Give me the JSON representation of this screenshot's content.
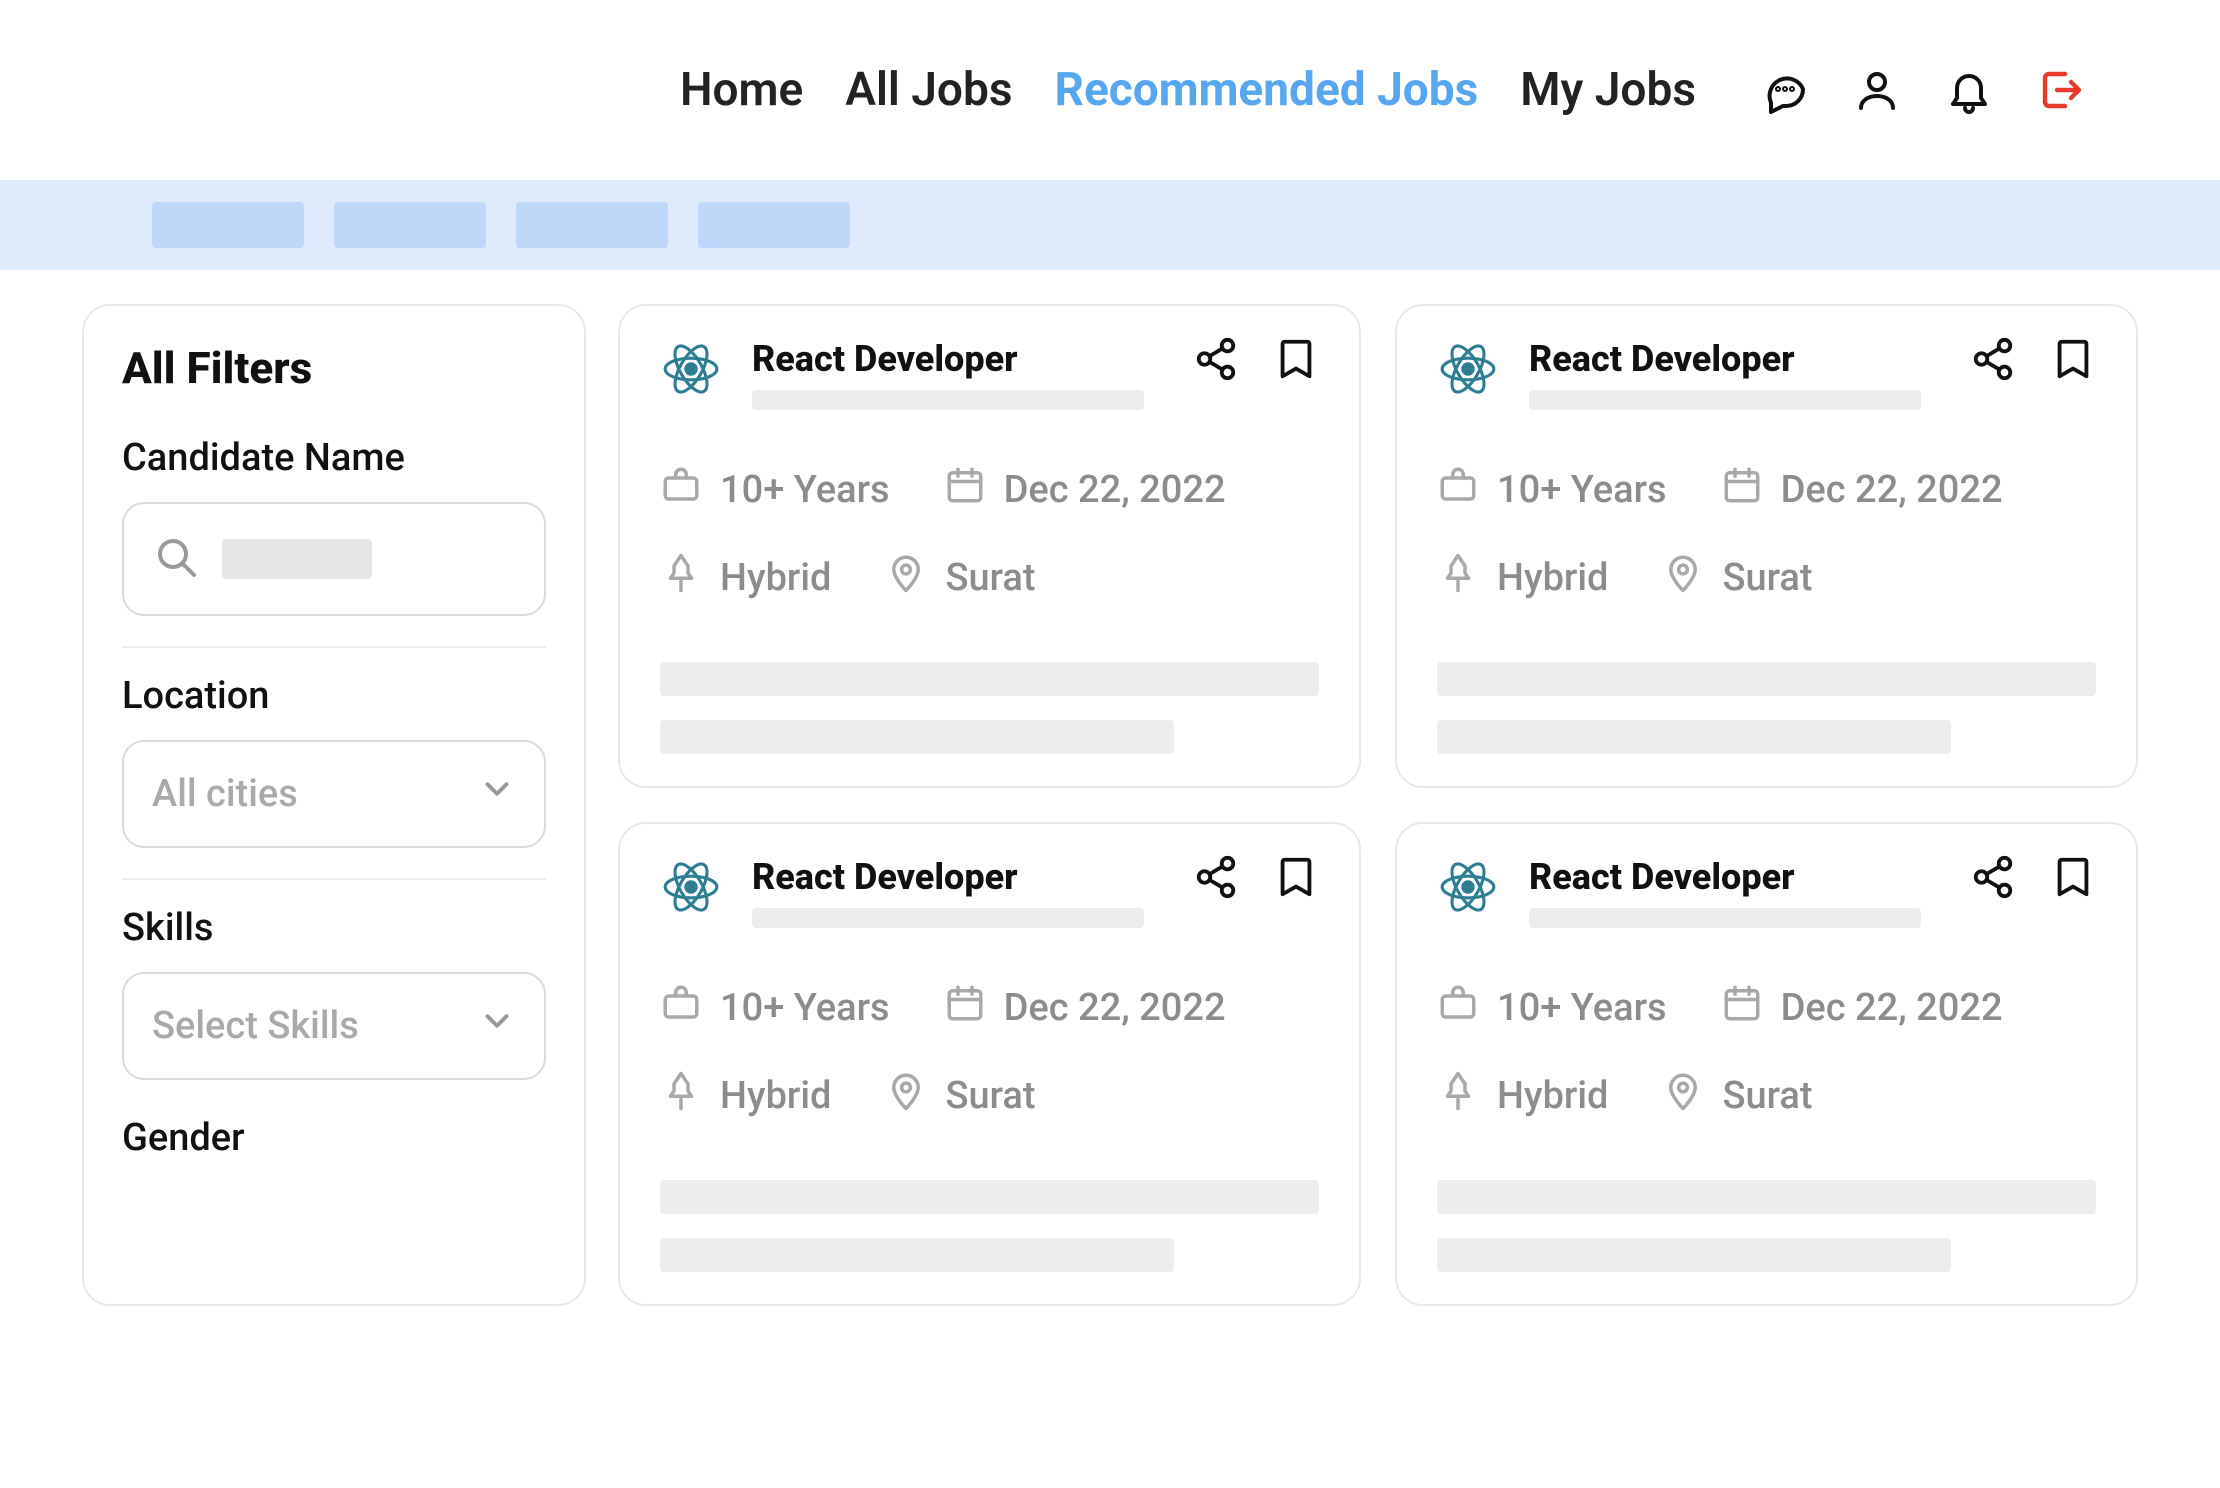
{
  "nav": {
    "links": [
      {
        "label": "Home",
        "active": false
      },
      {
        "label": "All Jobs",
        "active": false
      },
      {
        "label": "Recommended Jobs",
        "active": true
      },
      {
        "label": "My Jobs",
        "active": false
      }
    ]
  },
  "filters": {
    "title": "All Filters",
    "candidate_name": {
      "label": "Candidate Name"
    },
    "location": {
      "label": "Location",
      "placeholder": "All cities"
    },
    "skills": {
      "label": "Skills",
      "placeholder": "Select Skills"
    },
    "gender": {
      "label": "Gender"
    }
  },
  "jobs": [
    {
      "title": "React Developer",
      "experience": "10+ Years",
      "date": "Dec 22, 2022",
      "work_mode": "Hybrid",
      "city": "Surat"
    },
    {
      "title": "React Developer",
      "experience": "10+ Years",
      "date": "Dec 22, 2022",
      "work_mode": "Hybrid",
      "city": "Surat"
    },
    {
      "title": "React Developer",
      "experience": "10+ Years",
      "date": "Dec 22, 2022",
      "work_mode": "Hybrid",
      "city": "Surat"
    },
    {
      "title": "React Developer",
      "experience": "10+ Years",
      "date": "Dec 22, 2022",
      "work_mode": "Hybrid",
      "city": "Surat"
    }
  ]
}
